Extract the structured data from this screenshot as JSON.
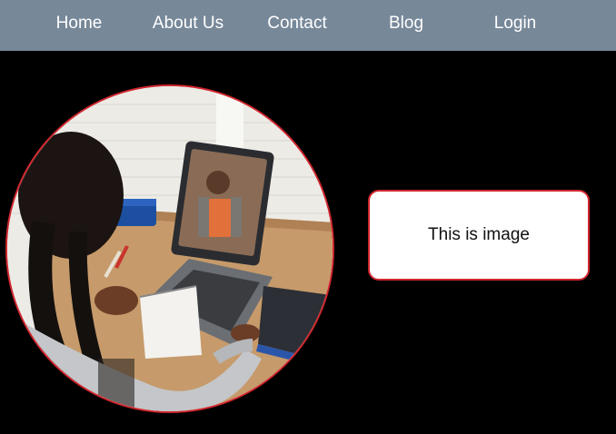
{
  "nav": {
    "items": [
      {
        "label": "Home"
      },
      {
        "label": "About Us"
      },
      {
        "label": "Contact"
      },
      {
        "label": "Blog"
      },
      {
        "label": "Login"
      }
    ]
  },
  "main": {
    "caption": "This is image"
  },
  "colors": {
    "navbar_bg": "#778899",
    "page_bg": "#000000",
    "accent_border": "#d1262e",
    "caption_bg": "#ffffff"
  }
}
